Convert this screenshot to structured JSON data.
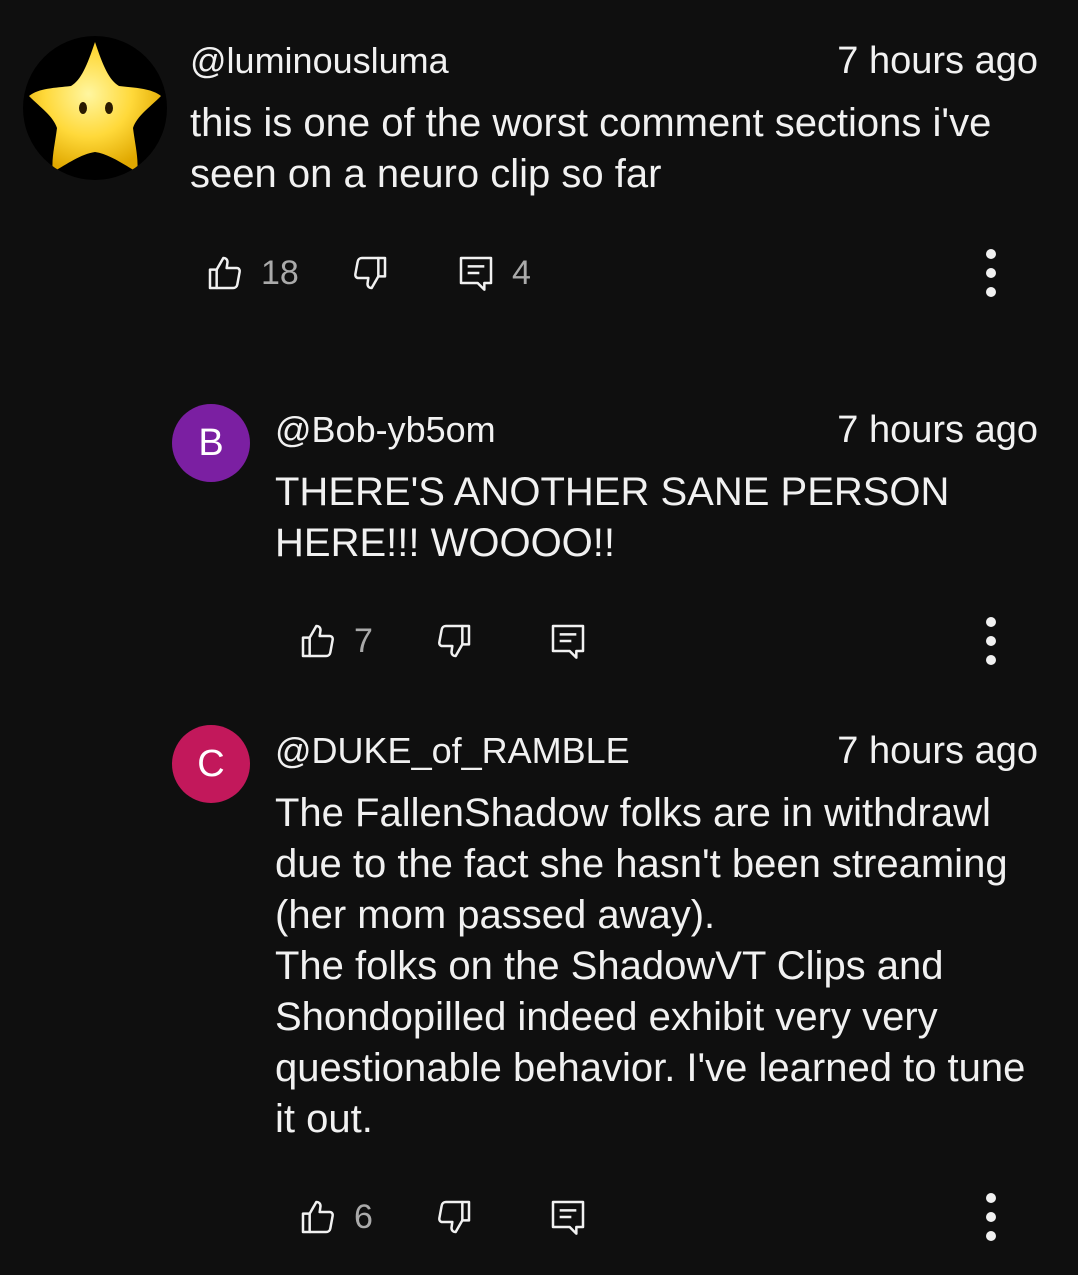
{
  "comments": [
    {
      "handle": "@luminousluma",
      "time": "7 hours ago",
      "text": "this is one of the worst comment sections i've seen on a neuro clip so far",
      "likes": "18",
      "replies": "4",
      "avatar_icon": "star-icon"
    },
    {
      "handle": "@Bob-yb5om",
      "time": "7 hours ago",
      "text": "THERE'S ANOTHER SANE PERSON HERE!!! WOOOO!!",
      "likes": "7",
      "avatar_letter": "B",
      "avatar_color": "#7b1fa2"
    },
    {
      "handle": "@DUKE_of_RAMBLE",
      "time": "7 hours ago",
      "text": "The FallenShadow folks are in withdrawl due to the fact she hasn't been streaming (her mom passed away).\nThe folks on the ShadowVT Clips and Shondopilled indeed exhibit very very questionable behavior. I've learned to tune it out.",
      "likes": "6",
      "avatar_letter": "C",
      "avatar_color": "#c2185b"
    }
  ],
  "icons": {
    "like": "thumbs-up-icon",
    "dislike": "thumbs-down-icon",
    "reply": "reply-icon",
    "more": "more-vertical-icon"
  },
  "colors": {
    "background": "#0f0f0f",
    "text": "#f1f1f1",
    "secondary_text": "#aaaaaa"
  }
}
